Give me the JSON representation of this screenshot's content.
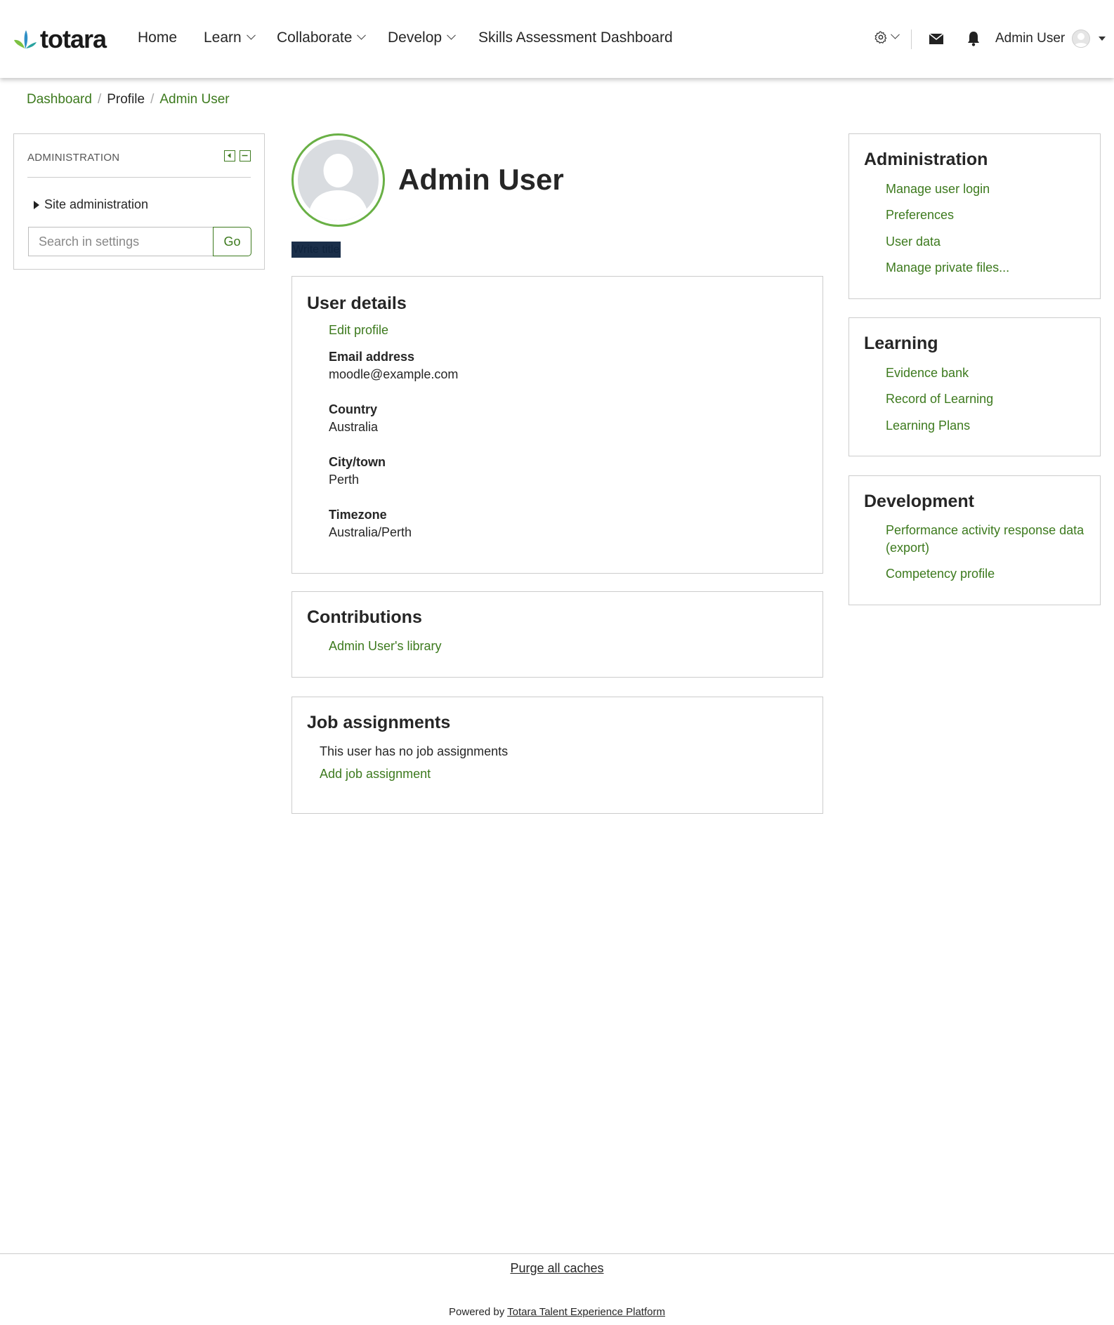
{
  "navbar": {
    "logo_text": "totara",
    "items": [
      {
        "label": "Home"
      },
      {
        "label": "Learn"
      },
      {
        "label": "Collaborate"
      },
      {
        "label": "Develop"
      },
      {
        "label": "Skills Assessment Dashboard"
      }
    ],
    "user_name": "Admin User"
  },
  "breadcrumb": {
    "items": [
      {
        "label": "Dashboard"
      },
      {
        "label": "Profile"
      },
      {
        "label": "Admin User"
      }
    ]
  },
  "admin_block": {
    "title": "ADMINISTRATION",
    "tree_item": "Site administration",
    "search_placeholder": "Search in settings",
    "go_label": "Go"
  },
  "profile": {
    "name": "Admin User",
    "highlight_text": "Write title"
  },
  "user_details": {
    "title": "User details",
    "edit_link": "Edit profile",
    "fields": [
      {
        "label": "Email address",
        "value": "moodle@example.com"
      },
      {
        "label": "Country",
        "value": "Australia"
      },
      {
        "label": "City/town",
        "value": "Perth"
      },
      {
        "label": "Timezone",
        "value": "Australia/Perth"
      }
    ]
  },
  "contributions": {
    "title": "Contributions",
    "link": "Admin User's library"
  },
  "job_assignments": {
    "title": "Job assignments",
    "message": "This user has no job assignments",
    "link": "Add job assignment"
  },
  "right_admin": {
    "title": "Administration",
    "links": [
      "Manage user login",
      "Preferences",
      "User data",
      "Manage private files..."
    ]
  },
  "right_learning": {
    "title": "Learning",
    "links": [
      "Evidence bank",
      "Record of Learning",
      "Learning Plans"
    ]
  },
  "right_development": {
    "title": "Development",
    "links": [
      "Performance activity response data (export)",
      "Competency profile"
    ]
  },
  "footer": {
    "purge_label": "Purge all caches",
    "powered_prefix": "Powered by ",
    "powered_link": "Totara Talent Experience Platform"
  },
  "colors": {
    "accent_green": "#3d7a1e",
    "avatar_ring": "#69b045"
  }
}
